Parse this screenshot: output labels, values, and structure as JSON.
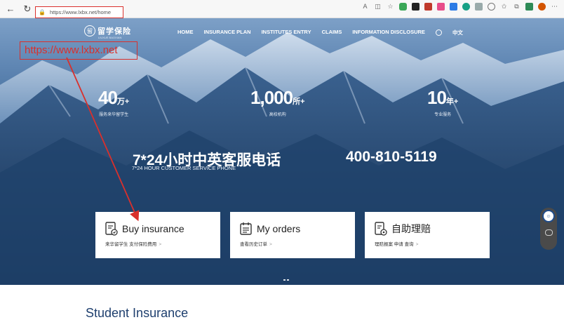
{
  "browser": {
    "url": "https://www.lxbx.net/home",
    "icons": [
      "reader-icon",
      "split-icon",
      "favorite-icon",
      "shield-icon",
      "ext-icon",
      "ext-icon",
      "ext-icon",
      "ext-icon",
      "ext-icon",
      "ext-icon",
      "ext-icon",
      "favorites-bar-icon",
      "collections-icon",
      "profile-icon",
      "more-icon"
    ]
  },
  "logo": {
    "mark": "留",
    "text": "留学保险",
    "sub": "LIUXUE BAOXIAN"
  },
  "nav": {
    "items": [
      "HOME",
      "INSURANCE PLAN",
      "INSTITUTES ENTRY",
      "CLAIMS",
      "INFORMATION DISCLOSURE"
    ],
    "lang": "中文"
  },
  "annotation": {
    "label": "https://www.lxbx.net"
  },
  "stats": [
    {
      "num": "40",
      "unit": "万+",
      "label": "服务来华留学生"
    },
    {
      "num": "1,000",
      "unit": "所+",
      "label": "高校机构"
    },
    {
      "num": "10",
      "unit": "年+",
      "label": "专业服务"
    }
  ],
  "service": {
    "title": "7*24小时中英客服电话",
    "subtitle": "7*24 HOUR CUSTOMER SERVICE PHONE",
    "phone": "400-810-5119"
  },
  "cards": [
    {
      "title": "Buy insurance",
      "sub": "来华留学生 支付保险费用",
      "chev": ">"
    },
    {
      "title": "My orders",
      "sub": "查看历史订单",
      "chev": ">"
    },
    {
      "title": "自助理赔",
      "sub": "理赔报案 申请 查询",
      "chev": ">"
    }
  ],
  "section": {
    "title": "Student Insurance"
  },
  "colors": {
    "annotation": "#d9302c",
    "section_title": "#1e3f6e"
  }
}
